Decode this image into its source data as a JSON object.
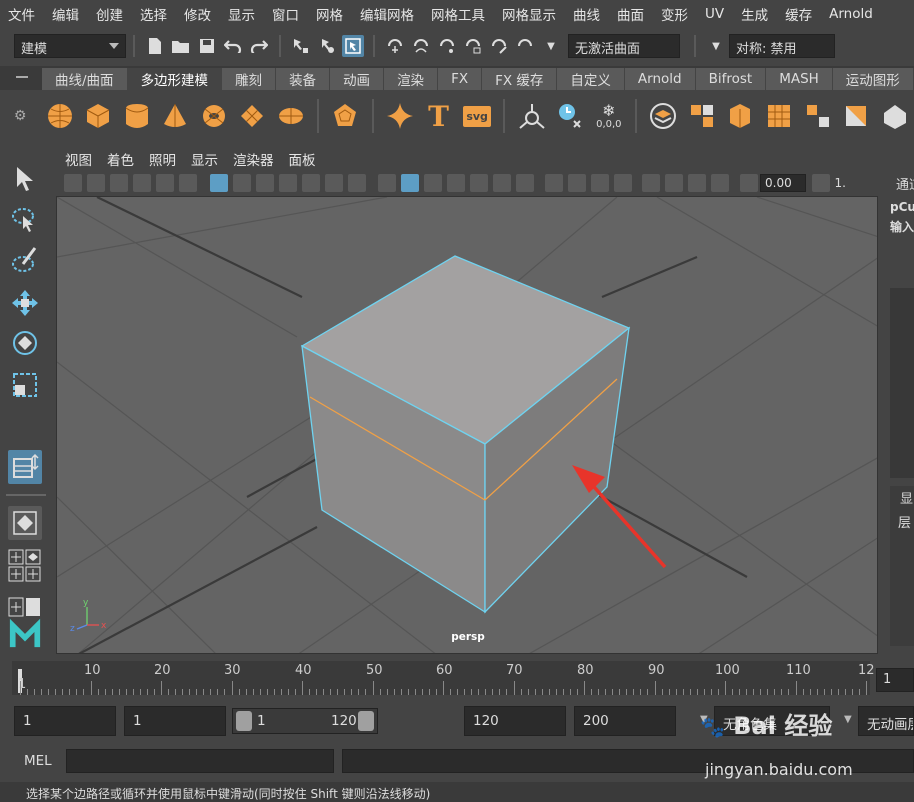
{
  "menubar": [
    "文件",
    "编辑",
    "创建",
    "选择",
    "修改",
    "显示",
    "窗口",
    "网格",
    "编辑网格",
    "网格工具",
    "网格显示",
    "曲线",
    "曲面",
    "变形",
    "UV",
    "生成",
    "缓存",
    "Arnold"
  ],
  "statusline": {
    "mode": "建模",
    "live_surface": "无激活曲面",
    "symmetry": "对称: 禁用"
  },
  "shelf": {
    "tabs": [
      "曲线/曲面",
      "多边形建模",
      "雕刻",
      "装备",
      "动画",
      "渲染",
      "FX",
      "FX 缓存",
      "自定义",
      "Arnold",
      "Bifrost",
      "MASH",
      "运动图形"
    ],
    "active_tab": "多边形建模",
    "svg_label": "svg",
    "text_label": "T",
    "coord_label": "0,0,0"
  },
  "panel": {
    "menus": [
      "视图",
      "着色",
      "照明",
      "显示",
      "渲染器",
      "面板"
    ],
    "exposure_value": "0.00",
    "gamma_value": "1.",
    "camera": "persp"
  },
  "right_panel": {
    "tab": "通道",
    "object": "pCu",
    "inputs": "输入",
    "display": "显",
    "layer": "层"
  },
  "axis_labels": {
    "x": "x",
    "y": "y",
    "z": "z"
  },
  "timeslider": {
    "ticks": [
      "10",
      "20",
      "30",
      "40",
      "50",
      "60",
      "70",
      "80",
      "90",
      "100",
      "110",
      "12"
    ],
    "current_frame": "1",
    "frame_box": "1"
  },
  "range": {
    "start": "1",
    "playback_start": "1",
    "slider_start": "1",
    "slider_end": "120",
    "playback_end": "120",
    "end": "200",
    "character_set": "无角色集",
    "anim_layer": "无动画层"
  },
  "command": {
    "language": "MEL"
  },
  "help_text": "选择某个边路径或循环并使用鼠标中键滑动(同时按住 Shift 键则沿法线移动)",
  "watermark": {
    "brand": "Bai 经验",
    "url": "jingyan.baidu.com"
  },
  "colors": {
    "selection_edge": "#6fd3f0",
    "edge_loop": "#f0a046",
    "accent_orange": "#f0a046",
    "active_tool": "#5285a6",
    "arrow": "#e8342a"
  }
}
